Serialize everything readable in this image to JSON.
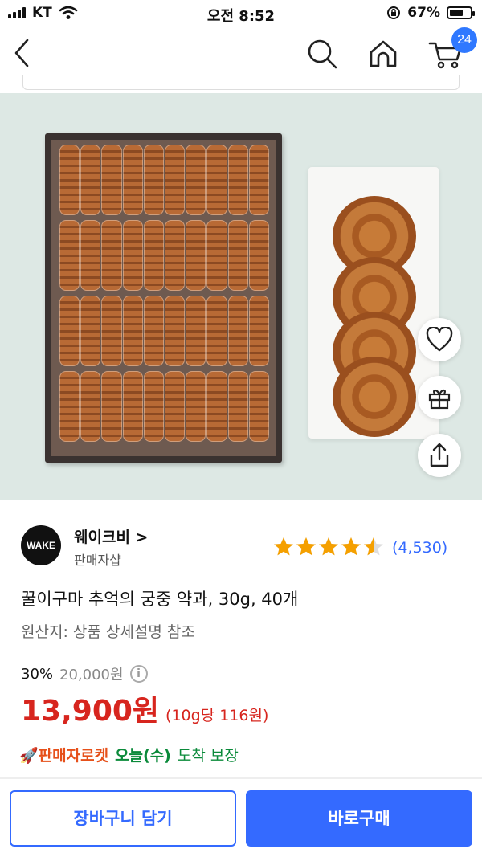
{
  "status_bar": {
    "carrier": "KT",
    "time": "오전 8:52",
    "battery_percent": "67%",
    "battery_level": 0.67
  },
  "nav": {
    "cart_count": "24",
    "icons": [
      "back-chevron-icon",
      "search-icon",
      "home-icon",
      "cart-icon"
    ]
  },
  "product": {
    "seller": {
      "logo_text": "WAKE",
      "name": "웨이크비 >",
      "type": "판매자샵"
    },
    "rating": {
      "stars": 4.5,
      "count": "(4,530)"
    },
    "title": "꿀이구마 추억의 궁중 약과, 30g, 40개",
    "origin": "원산지: 상품 상세설명 참조",
    "discount_percent": "30%",
    "original_price": "20,000원",
    "price": "13,900원",
    "unit_price": "(10g당 116원)",
    "delivery": {
      "badge": "🚀판매자로켓",
      "day": "오늘(수)",
      "text": "도착 보장"
    }
  },
  "actions": {
    "add_to_cart": "장바구니 담기",
    "buy_now": "바로구매",
    "side_icons": [
      "heart-icon",
      "gift-icon",
      "share-icon"
    ]
  },
  "colors": {
    "accent": "#346aff",
    "price": "#d7251e",
    "delivery_green": "#0a8a3a",
    "rocket": "#e6501a",
    "star": "#f5a000"
  }
}
